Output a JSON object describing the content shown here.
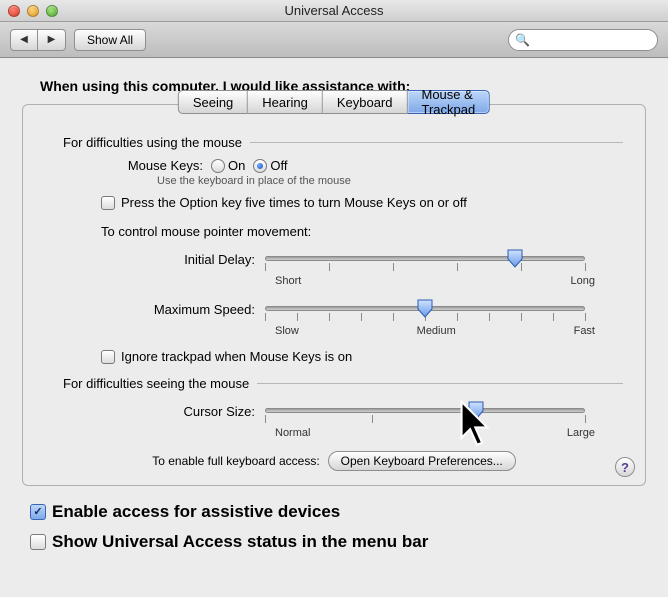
{
  "window": {
    "title": "Universal Access"
  },
  "toolbar": {
    "back_label": "◀",
    "fwd_label": "▶",
    "show_all": "Show All",
    "search_placeholder": ""
  },
  "heading": "When using this computer, I would like assistance with:",
  "tabs": {
    "seeing": "Seeing",
    "hearing": "Hearing",
    "keyboard": "Keyboard",
    "mouse": "Mouse & Trackpad",
    "active": "mouse"
  },
  "mouse_section": {
    "heading": "For difficulties using the mouse",
    "mouse_keys_label": "Mouse Keys:",
    "on": "On",
    "off": "Off",
    "mouse_keys_value": "off",
    "hint": "Use the keyboard in place of the mouse",
    "option_toggle": "Press the Option key five times to turn Mouse Keys on or off",
    "option_toggle_checked": false,
    "control_heading": "To control mouse pointer movement:",
    "initial_delay": {
      "label": "Initial Delay:",
      "min_label": "Short",
      "max_label": "Long",
      "value": 0.78
    },
    "max_speed": {
      "label": "Maximum Speed:",
      "min_label": "Slow",
      "mid_label": "Medium",
      "max_label": "Fast",
      "value": 0.5
    },
    "ignore_trackpad": "Ignore trackpad when Mouse Keys is on",
    "ignore_trackpad_checked": false
  },
  "seeing_section": {
    "heading": "For difficulties seeing the mouse",
    "cursor_size": {
      "label": "Cursor Size:",
      "min_label": "Normal",
      "max_label": "Large",
      "value": 0.66
    },
    "kbd_access_label": "To enable full keyboard access:",
    "open_kbd_btn": "Open Keyboard Preferences..."
  },
  "help_label": "?",
  "bottom": {
    "enable_assistive": "Enable access for assistive devices",
    "enable_assistive_checked": true,
    "show_status": "Show Universal Access status in the menu bar",
    "show_status_checked": false
  }
}
